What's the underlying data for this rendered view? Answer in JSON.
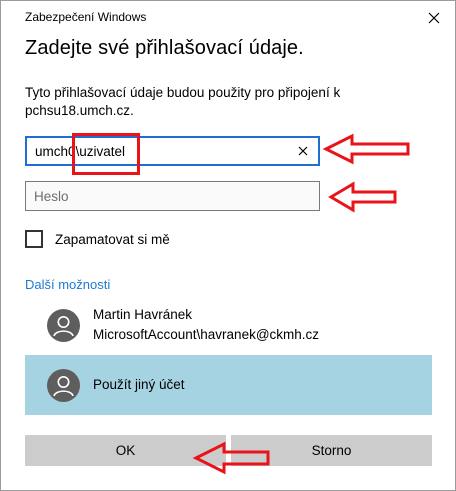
{
  "window": {
    "title": "Zabezpečení Windows"
  },
  "heading": "Zadejte své přihlašovací údaje.",
  "description": "Tyto přihlašovací údaje budou použity pro připojení k pchsu18.umch.cz.",
  "username_field": {
    "value": "umch0\\uzivatel"
  },
  "password_field": {
    "placeholder": "Heslo",
    "value": ""
  },
  "remember": {
    "label": "Zapamatovat si mě",
    "checked": false
  },
  "more_options_label": "Další možnosti",
  "accounts": [
    {
      "name": "Martin Havránek",
      "sub": "MicrosoftAccount\\havranek@ckmh.cz",
      "selected": false,
      "icon": "user-avatar-icon"
    },
    {
      "name": "Použít jiný účet",
      "sub": "",
      "selected": true,
      "icon": "user-avatar-icon"
    }
  ],
  "buttons": {
    "ok": "OK",
    "cancel": "Storno"
  },
  "colors": {
    "accent": "#1f6ed4",
    "link": "#1e7ad1",
    "selected_bg": "#a6d3e2",
    "button_bg": "#cccccc",
    "annotation_red": "#e8141a"
  }
}
